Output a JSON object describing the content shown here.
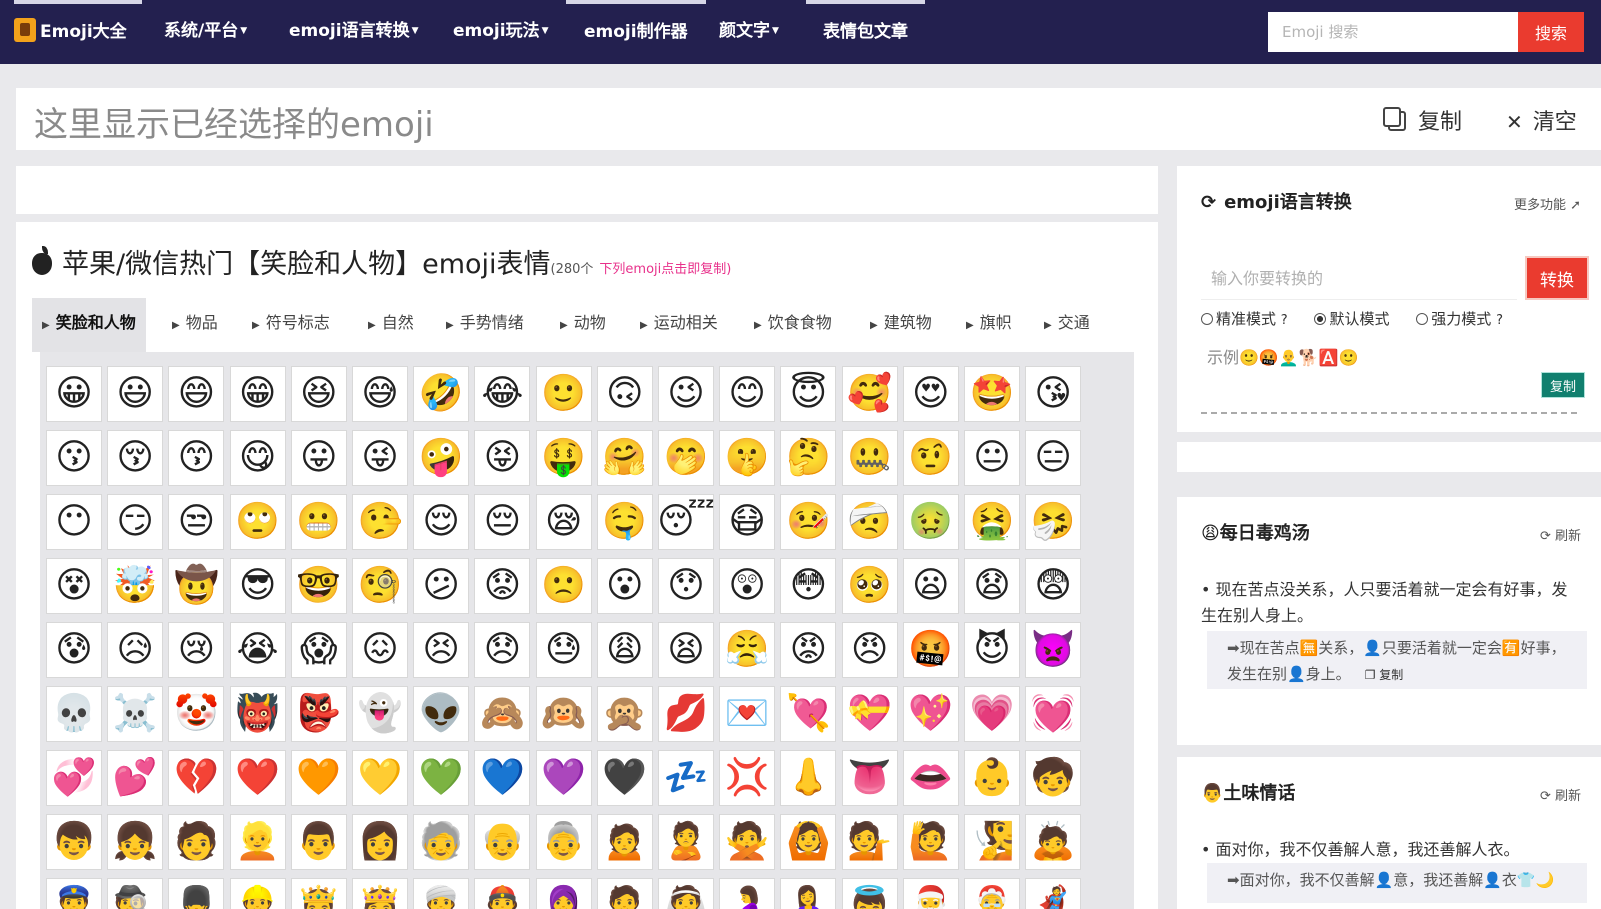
{
  "nav": {
    "logo": "Emoji大全",
    "items": [
      "系统/平台",
      "emoji语言转换",
      "emoji玩法",
      "emoji制作器",
      "颜文字",
      "表情包文章"
    ],
    "search_placeholder": "Emoji 搜索",
    "search_button": "搜索"
  },
  "selected": {
    "placeholder": "这里显示已经选择的emoji",
    "copy": "复制",
    "clear": "清空"
  },
  "main": {
    "title": "苹果/微信热门【笑脸和人物】emoji表情",
    "count": "(280个",
    "hint": "下列emoji点击即复制)",
    "tabs": [
      "笑脸和人物",
      "物品",
      "符号标志",
      "自然",
      "手势情绪",
      "动物",
      "运动相关",
      "饮食食物",
      "建筑物",
      "旗帜",
      "交通"
    ]
  },
  "emojis": [
    [
      "😀",
      "😃",
      "😄",
      "😁",
      "😆",
      "😅",
      "🤣",
      "😂",
      "🙂",
      "🙃",
      "😉",
      "😊",
      "😇",
      "🥰",
      "😍",
      "🤩",
      "😘"
    ],
    [
      "😗",
      "😚",
      "😙",
      "😋",
      "😛",
      "😜",
      "🤪",
      "😝",
      "🤑",
      "🤗",
      "🤭",
      "🤫",
      "🤔",
      "🤐",
      "🤨",
      "😐",
      "😑"
    ],
    [
      "😶",
      "😏",
      "😒",
      "🙄",
      "😬",
      "🤥",
      "😌",
      "😔",
      "😪",
      "🤤",
      "😴",
      "😷",
      "🤒",
      "🤕",
      "🤢",
      "🤮",
      "🤧"
    ],
    [
      "😵",
      "🤯",
      "🤠",
      "😎",
      "🤓",
      "🧐",
      "😕",
      "😟",
      "🙁",
      "😮",
      "😯",
      "😲",
      "😳",
      "🥺",
      "😦",
      "😧",
      "😨"
    ],
    [
      "😰",
      "😥",
      "😢",
      "😭",
      "😱",
      "😖",
      "😣",
      "😞",
      "😓",
      "😩",
      "😫",
      "😤",
      "😡",
      "😠",
      "🤬",
      "😈",
      "👿"
    ],
    [
      "💀",
      "☠️",
      "🤡",
      "👹",
      "👺",
      "👻",
      "👽",
      "🙈",
      "🙉",
      "🙊",
      "💋",
      "💌",
      "💘",
      "💝",
      "💖",
      "💗",
      "💓"
    ],
    [
      "💞",
      "💕",
      "💔",
      "❤️",
      "🧡",
      "💛",
      "💚",
      "💙",
      "💜",
      "🖤",
      "💤",
      "💢",
      "👃",
      "👅",
      "👄",
      "👶",
      "🧒"
    ],
    [
      "👦",
      "👧",
      "🧑",
      "👱",
      "👨",
      "👩",
      "🧓",
      "👴",
      "👵",
      "🙍",
      "🙎",
      "🙅",
      "🙆",
      "💁",
      "🙋",
      "🧏",
      "🙇"
    ],
    [
      "👮",
      "🕵️",
      "💂",
      "👷",
      "🤴",
      "👸",
      "👳",
      "👲",
      "🧕",
      "🤵",
      "👰",
      "🤰",
      "🤱",
      "👼",
      "🎅",
      "🤶",
      "🦸"
    ]
  ],
  "converter": {
    "title": "emoji语言转换",
    "more": "更多功能",
    "input_placeholder": "输入你要转换的",
    "button": "转换",
    "modes": [
      "精准模式",
      "默认模式",
      "强力模式"
    ],
    "result": "示例🙂🤬👨‍🦲🐕🅰️🙂",
    "copy": "复制"
  },
  "soup": {
    "title": "每日毒鸡汤",
    "refresh": "刷新",
    "quote": "现在苦点没关系，人只要活着就一定会有好事，发生在别人身上。",
    "emoji_line": "➡现在苦点🈚关系，👤只要活着就一定会🈶好事，发生在别👤身上。",
    "copy": "复制"
  },
  "love": {
    "title": "土味情话",
    "refresh": "刷新",
    "quote": "面对你，我不仅善解人意，我还善解人衣。",
    "emoji_line": "➡面对你，我不仅善解👤意，我还善解👤衣👕🌙"
  }
}
